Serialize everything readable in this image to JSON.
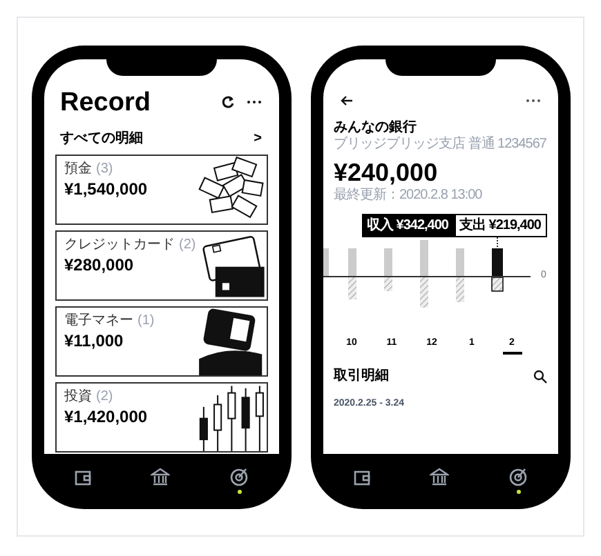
{
  "left_phone": {
    "title": "Record",
    "all_link": {
      "label": "すべての明細",
      "chevron": ">"
    },
    "cards": [
      {
        "kind": "cash",
        "label": "預金",
        "count": "(3)",
        "amount": "¥1,540,000"
      },
      {
        "kind": "card",
        "label": "クレジットカード",
        "count": "(2)",
        "amount": "¥280,000"
      },
      {
        "kind": "emoney",
        "label": "電子マネー",
        "count": "(1)",
        "amount": "¥11,000"
      },
      {
        "kind": "invest",
        "label": "投資",
        "count": "(2)",
        "amount": "¥1,420,000"
      }
    ],
    "nav": [
      {
        "kind": "wallet",
        "selected": false
      },
      {
        "kind": "bank",
        "selected": false
      },
      {
        "kind": "target",
        "selected": true
      }
    ]
  },
  "right_phone": {
    "bank_name": "みんなの銀行",
    "branch": "ブリッジブリッジ支店 普通 1234567",
    "balance": "¥240,000",
    "updated": "最終更新：2020.2.8 13:00",
    "toggle": [
      {
        "label": "収入 ¥342,400",
        "selected": true
      },
      {
        "label": "支出 ¥219,400",
        "selected": false
      }
    ],
    "zero_label": "0",
    "months": [
      {
        "label": "10",
        "selected": false
      },
      {
        "label": "11",
        "selected": false
      },
      {
        "label": "12",
        "selected": false
      },
      {
        "label": "1",
        "selected": false
      },
      {
        "label": "2",
        "selected": true
      }
    ],
    "section_title": "取引明細",
    "period": "2020.2.25 - 3.24",
    "nav": [
      {
        "kind": "wallet",
        "selected": false
      },
      {
        "kind": "bank",
        "selected": false
      },
      {
        "kind": "target",
        "selected": true
      }
    ]
  }
}
